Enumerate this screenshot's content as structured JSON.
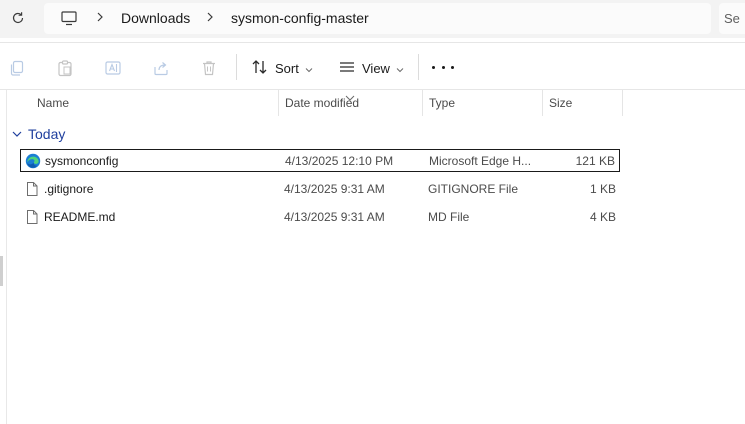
{
  "address_bar": {
    "breadcrumbs": [
      "Downloads",
      "sysmon-config-master"
    ],
    "search_partial": "Se"
  },
  "toolbar": {
    "sort_label": "Sort",
    "view_label": "View"
  },
  "columns": {
    "name": "Name",
    "date_modified": "Date modified",
    "type": "Type",
    "size": "Size"
  },
  "group": {
    "label": "Today"
  },
  "files": [
    {
      "name": "sysmonconfig",
      "date": "4/13/2025 12:10 PM",
      "type": "Microsoft Edge H...",
      "size": "121 KB",
      "icon": "edge-icon",
      "selected": true
    },
    {
      "name": ".gitignore",
      "date": "4/13/2025 9:31 AM",
      "type": "GITIGNORE File",
      "size": "1 KB",
      "icon": "file-icon",
      "selected": false
    },
    {
      "name": "README.md",
      "date": "4/13/2025 9:31 AM",
      "type": "MD File",
      "size": "4 KB",
      "icon": "file-icon",
      "selected": false
    }
  ],
  "colors": {
    "group_label": "#1f3f9e",
    "toolbar_bg": "#f3f3f3"
  }
}
